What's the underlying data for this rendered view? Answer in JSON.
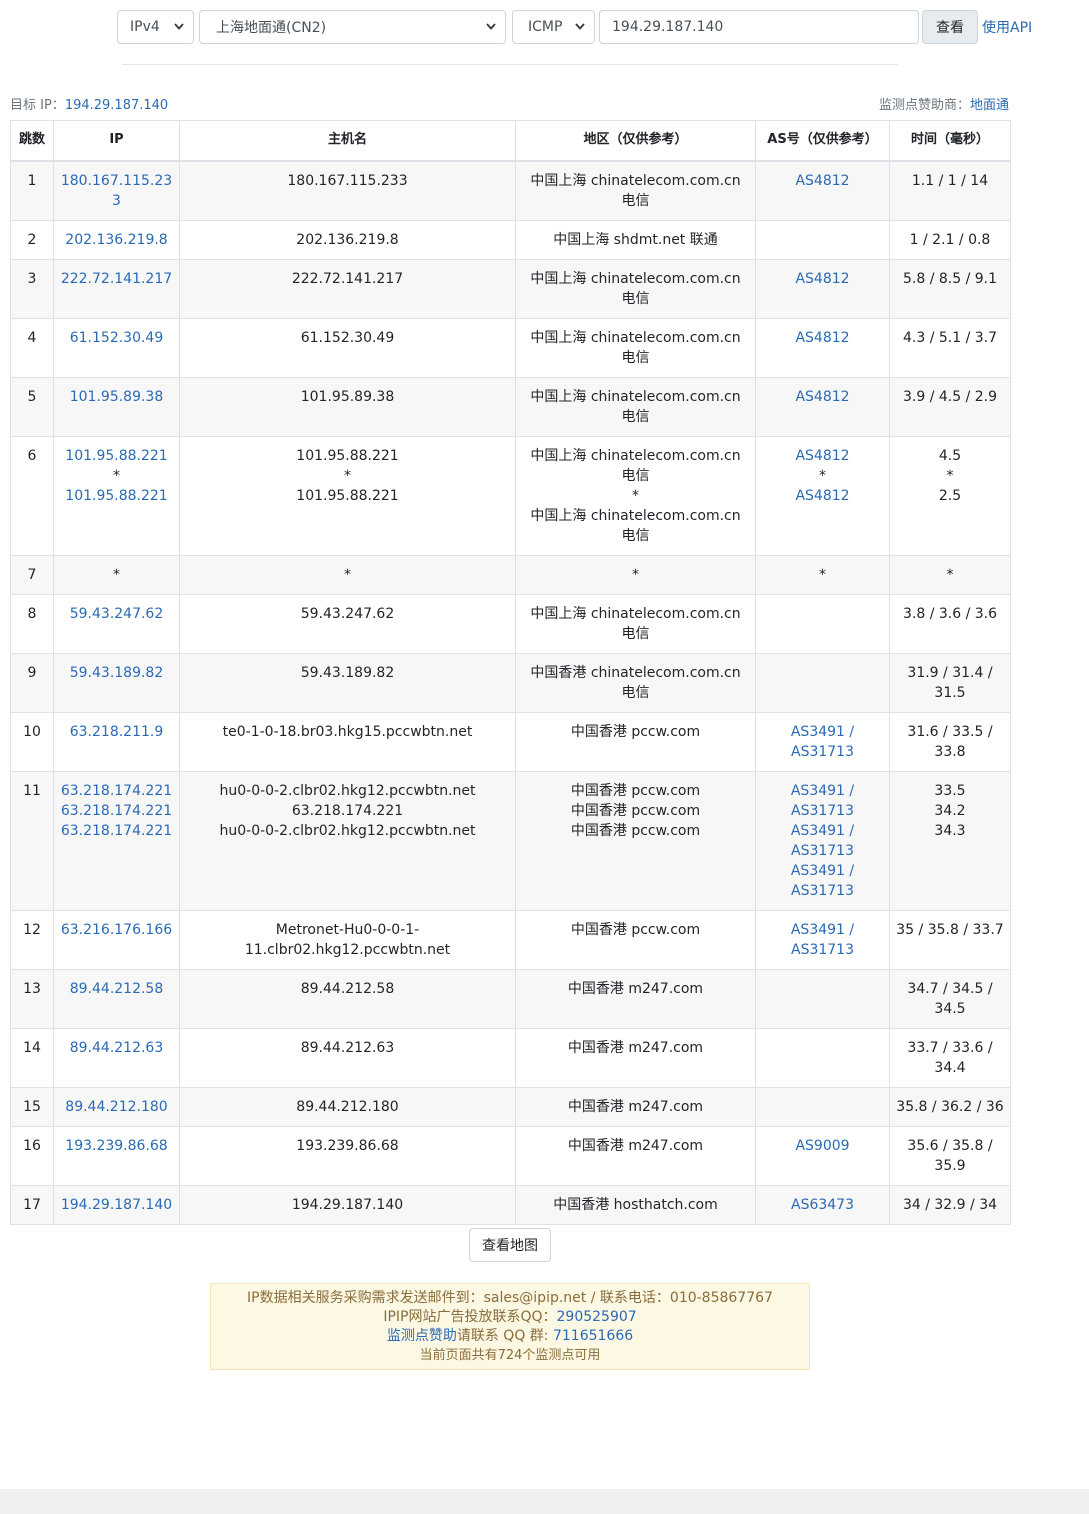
{
  "form": {
    "ip_version": "IPv4",
    "node": "上海地面通(CN2)",
    "protocol": "ICMP",
    "target_value": "194.29.187.140",
    "submit_label": "查看",
    "api_label": "使用API"
  },
  "meta": {
    "target_label": "目标 IP：",
    "target_ip": "194.29.187.140",
    "sponsor_label": "监测点赞助商：",
    "sponsor_name": "地面通"
  },
  "table": {
    "headers": [
      "跳数",
      "IP",
      "主机名",
      "地区（仅供参考）",
      "AS号（仅供参考）",
      "时间（毫秒）"
    ],
    "rows": [
      {
        "hop": "1",
        "ip": [
          "180.167.115.233"
        ],
        "host": [
          "180.167.115.233"
        ],
        "region": [
          "中国上海 chinatelecom.com.cn 电信"
        ],
        "as": [
          "AS4812"
        ],
        "time": [
          "1.1 / 1 / 14"
        ]
      },
      {
        "hop": "2",
        "ip": [
          "202.136.219.8"
        ],
        "host": [
          "202.136.219.8"
        ],
        "region": [
          "中国上海 shdmt.net 联通"
        ],
        "as": [],
        "time": [
          "1 / 2.1 / 0.8"
        ]
      },
      {
        "hop": "3",
        "ip": [
          "222.72.141.217"
        ],
        "host": [
          "222.72.141.217"
        ],
        "region": [
          "中国上海 chinatelecom.com.cn 电信"
        ],
        "as": [
          "AS4812"
        ],
        "time": [
          "5.8 / 8.5 / 9.1"
        ]
      },
      {
        "hop": "4",
        "ip": [
          "61.152.30.49"
        ],
        "host": [
          "61.152.30.49"
        ],
        "region": [
          "中国上海 chinatelecom.com.cn 电信"
        ],
        "as": [
          "AS4812"
        ],
        "time": [
          "4.3 / 5.1 / 3.7"
        ]
      },
      {
        "hop": "5",
        "ip": [
          "101.95.89.38"
        ],
        "host": [
          "101.95.89.38"
        ],
        "region": [
          "中国上海 chinatelecom.com.cn 电信"
        ],
        "as": [
          "AS4812"
        ],
        "time": [
          "3.9 / 4.5 / 2.9"
        ]
      },
      {
        "hop": "6",
        "ip": [
          "101.95.88.221",
          "*",
          "101.95.88.221"
        ],
        "host": [
          "101.95.88.221",
          "*",
          "101.95.88.221"
        ],
        "region": [
          "中国上海 chinatelecom.com.cn 电信",
          "*",
          "中国上海 chinatelecom.com.cn 电信"
        ],
        "as": [
          "AS4812",
          "*",
          "AS4812"
        ],
        "time": [
          "4.5",
          "*",
          "2.5"
        ]
      },
      {
        "hop": "7",
        "ip": [
          "*"
        ],
        "host": [
          "*"
        ],
        "region": [
          "*"
        ],
        "as": [
          "*"
        ],
        "time": [
          "*"
        ]
      },
      {
        "hop": "8",
        "ip": [
          "59.43.247.62"
        ],
        "host": [
          "59.43.247.62"
        ],
        "region": [
          "中国上海 chinatelecom.com.cn 电信"
        ],
        "as": [],
        "time": [
          "3.8 / 3.6 / 3.6"
        ]
      },
      {
        "hop": "9",
        "ip": [
          "59.43.189.82"
        ],
        "host": [
          "59.43.189.82"
        ],
        "region": [
          "中国香港 chinatelecom.com.cn 电信"
        ],
        "as": [],
        "time": [
          "31.9 / 31.4 / 31.5"
        ]
      },
      {
        "hop": "10",
        "ip": [
          "63.218.211.9"
        ],
        "host": [
          "te0-1-0-18.br03.hkg15.pccwbtn.net"
        ],
        "region": [
          "中国香港 pccw.com"
        ],
        "as": [
          "AS3491 / AS31713"
        ],
        "time": [
          "31.6 / 33.5 / 33.8"
        ]
      },
      {
        "hop": "11",
        "ip": [
          "63.218.174.221",
          "63.218.174.221",
          "63.218.174.221"
        ],
        "host": [
          "hu0-0-0-2.clbr02.hkg12.pccwbtn.net",
          "63.218.174.221",
          "hu0-0-0-2.clbr02.hkg12.pccwbtn.net"
        ],
        "region": [
          "中国香港 pccw.com",
          "中国香港 pccw.com",
          "中国香港 pccw.com"
        ],
        "as": [
          "AS3491 / AS31713",
          "AS3491 / AS31713",
          "AS3491 / AS31713"
        ],
        "time": [
          "33.5",
          "34.2",
          "34.3"
        ]
      },
      {
        "hop": "12",
        "ip": [
          "63.216.176.166"
        ],
        "host": [
          "Metronet-Hu0-0-0-1-11.clbr02.hkg12.pccwbtn.net"
        ],
        "region": [
          "中国香港 pccw.com"
        ],
        "as": [
          "AS3491 / AS31713"
        ],
        "time": [
          "35 / 35.8 / 33.7"
        ]
      },
      {
        "hop": "13",
        "ip": [
          "89.44.212.58"
        ],
        "host": [
          "89.44.212.58"
        ],
        "region": [
          "中国香港 m247.com"
        ],
        "as": [],
        "time": [
          "34.7 / 34.5 / 34.5"
        ]
      },
      {
        "hop": "14",
        "ip": [
          "89.44.212.63"
        ],
        "host": [
          "89.44.212.63"
        ],
        "region": [
          "中国香港 m247.com"
        ],
        "as": [],
        "time": [
          "33.7 / 33.6 / 34.4"
        ]
      },
      {
        "hop": "15",
        "ip": [
          "89.44.212.180"
        ],
        "host": [
          "89.44.212.180"
        ],
        "region": [
          "中国香港 m247.com"
        ],
        "as": [],
        "time": [
          "35.8 / 36.2 / 36"
        ]
      },
      {
        "hop": "16",
        "ip": [
          "193.239.86.68"
        ],
        "host": [
          "193.239.86.68"
        ],
        "region": [
          "中国香港 m247.com"
        ],
        "as": [
          "AS9009"
        ],
        "time": [
          "35.6 / 35.8 / 35.9"
        ]
      },
      {
        "hop": "17",
        "ip": [
          "194.29.187.140"
        ],
        "host": [
          "194.29.187.140"
        ],
        "region": [
          "中国香港 hosthatch.com"
        ],
        "as": [
          "AS63473"
        ],
        "time": [
          "34 / 32.9 / 34"
        ]
      }
    ]
  },
  "map_button_label": "查看地图",
  "footer": {
    "line1_prefix": "IP数据相关服务采购需求发送邮件到：",
    "email": "sales@ipip.net",
    "line1_mid": " / 联系电话：",
    "phone": "010-85867767",
    "line2_prefix": "IPIP网站广告投放联系QQ：",
    "qq_ads": "290525907",
    "line3_link": "监测点赞助",
    "line3_mid": "请联系 QQ 群: ",
    "qq_group": "711651666",
    "line4": "当前页面共有724个监测点可用"
  },
  "icons": {
    "select_caret": "chevron-down-icon"
  }
}
